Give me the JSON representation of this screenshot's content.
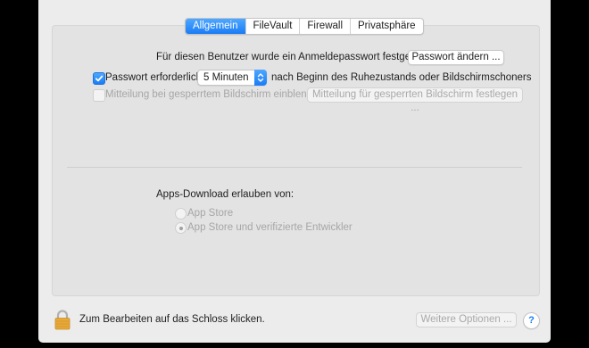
{
  "tabs": [
    {
      "label": "Allgemein",
      "active": true
    },
    {
      "label": "FileVault",
      "active": false
    },
    {
      "label": "Firewall",
      "active": false
    },
    {
      "label": "Privatsphäre",
      "active": false
    }
  ],
  "general": {
    "login_password_text": "Für diesen Benutzer wurde ein Anmeldepasswort festgelegt",
    "change_password_button": "Passwort ändern ...",
    "require_password": {
      "label": "Passwort erforderlich",
      "checked": true,
      "delay_value": "5 Minuten",
      "suffix": "nach Beginn des Ruhezustands oder Bildschirmschoners"
    },
    "lock_message": {
      "label": "Mitteilung bei gesperrtem Bildschirm einblenden",
      "checked": false,
      "enabled": false,
      "button": "Mitteilung für gesperrten Bildschirm festlegen ..."
    }
  },
  "apps_download": {
    "heading": "Apps-Download erlauben von:",
    "options": [
      {
        "label": "App Store",
        "selected": false,
        "enabled": false
      },
      {
        "label": "App Store und verifizierte Entwickler",
        "selected": true,
        "enabled": false
      }
    ]
  },
  "footer": {
    "lock_text": "Zum Bearbeiten auf das Schloss klicken.",
    "advanced_button": "Weitere Optionen ...",
    "help_label": "?"
  },
  "colors": {
    "accent": "#1a7cf5",
    "background": "#ececec",
    "lock": "#e8a93a"
  },
  "icons": [
    "checkmark-icon",
    "popup-arrows-icon",
    "lock-icon",
    "help-icon"
  ]
}
